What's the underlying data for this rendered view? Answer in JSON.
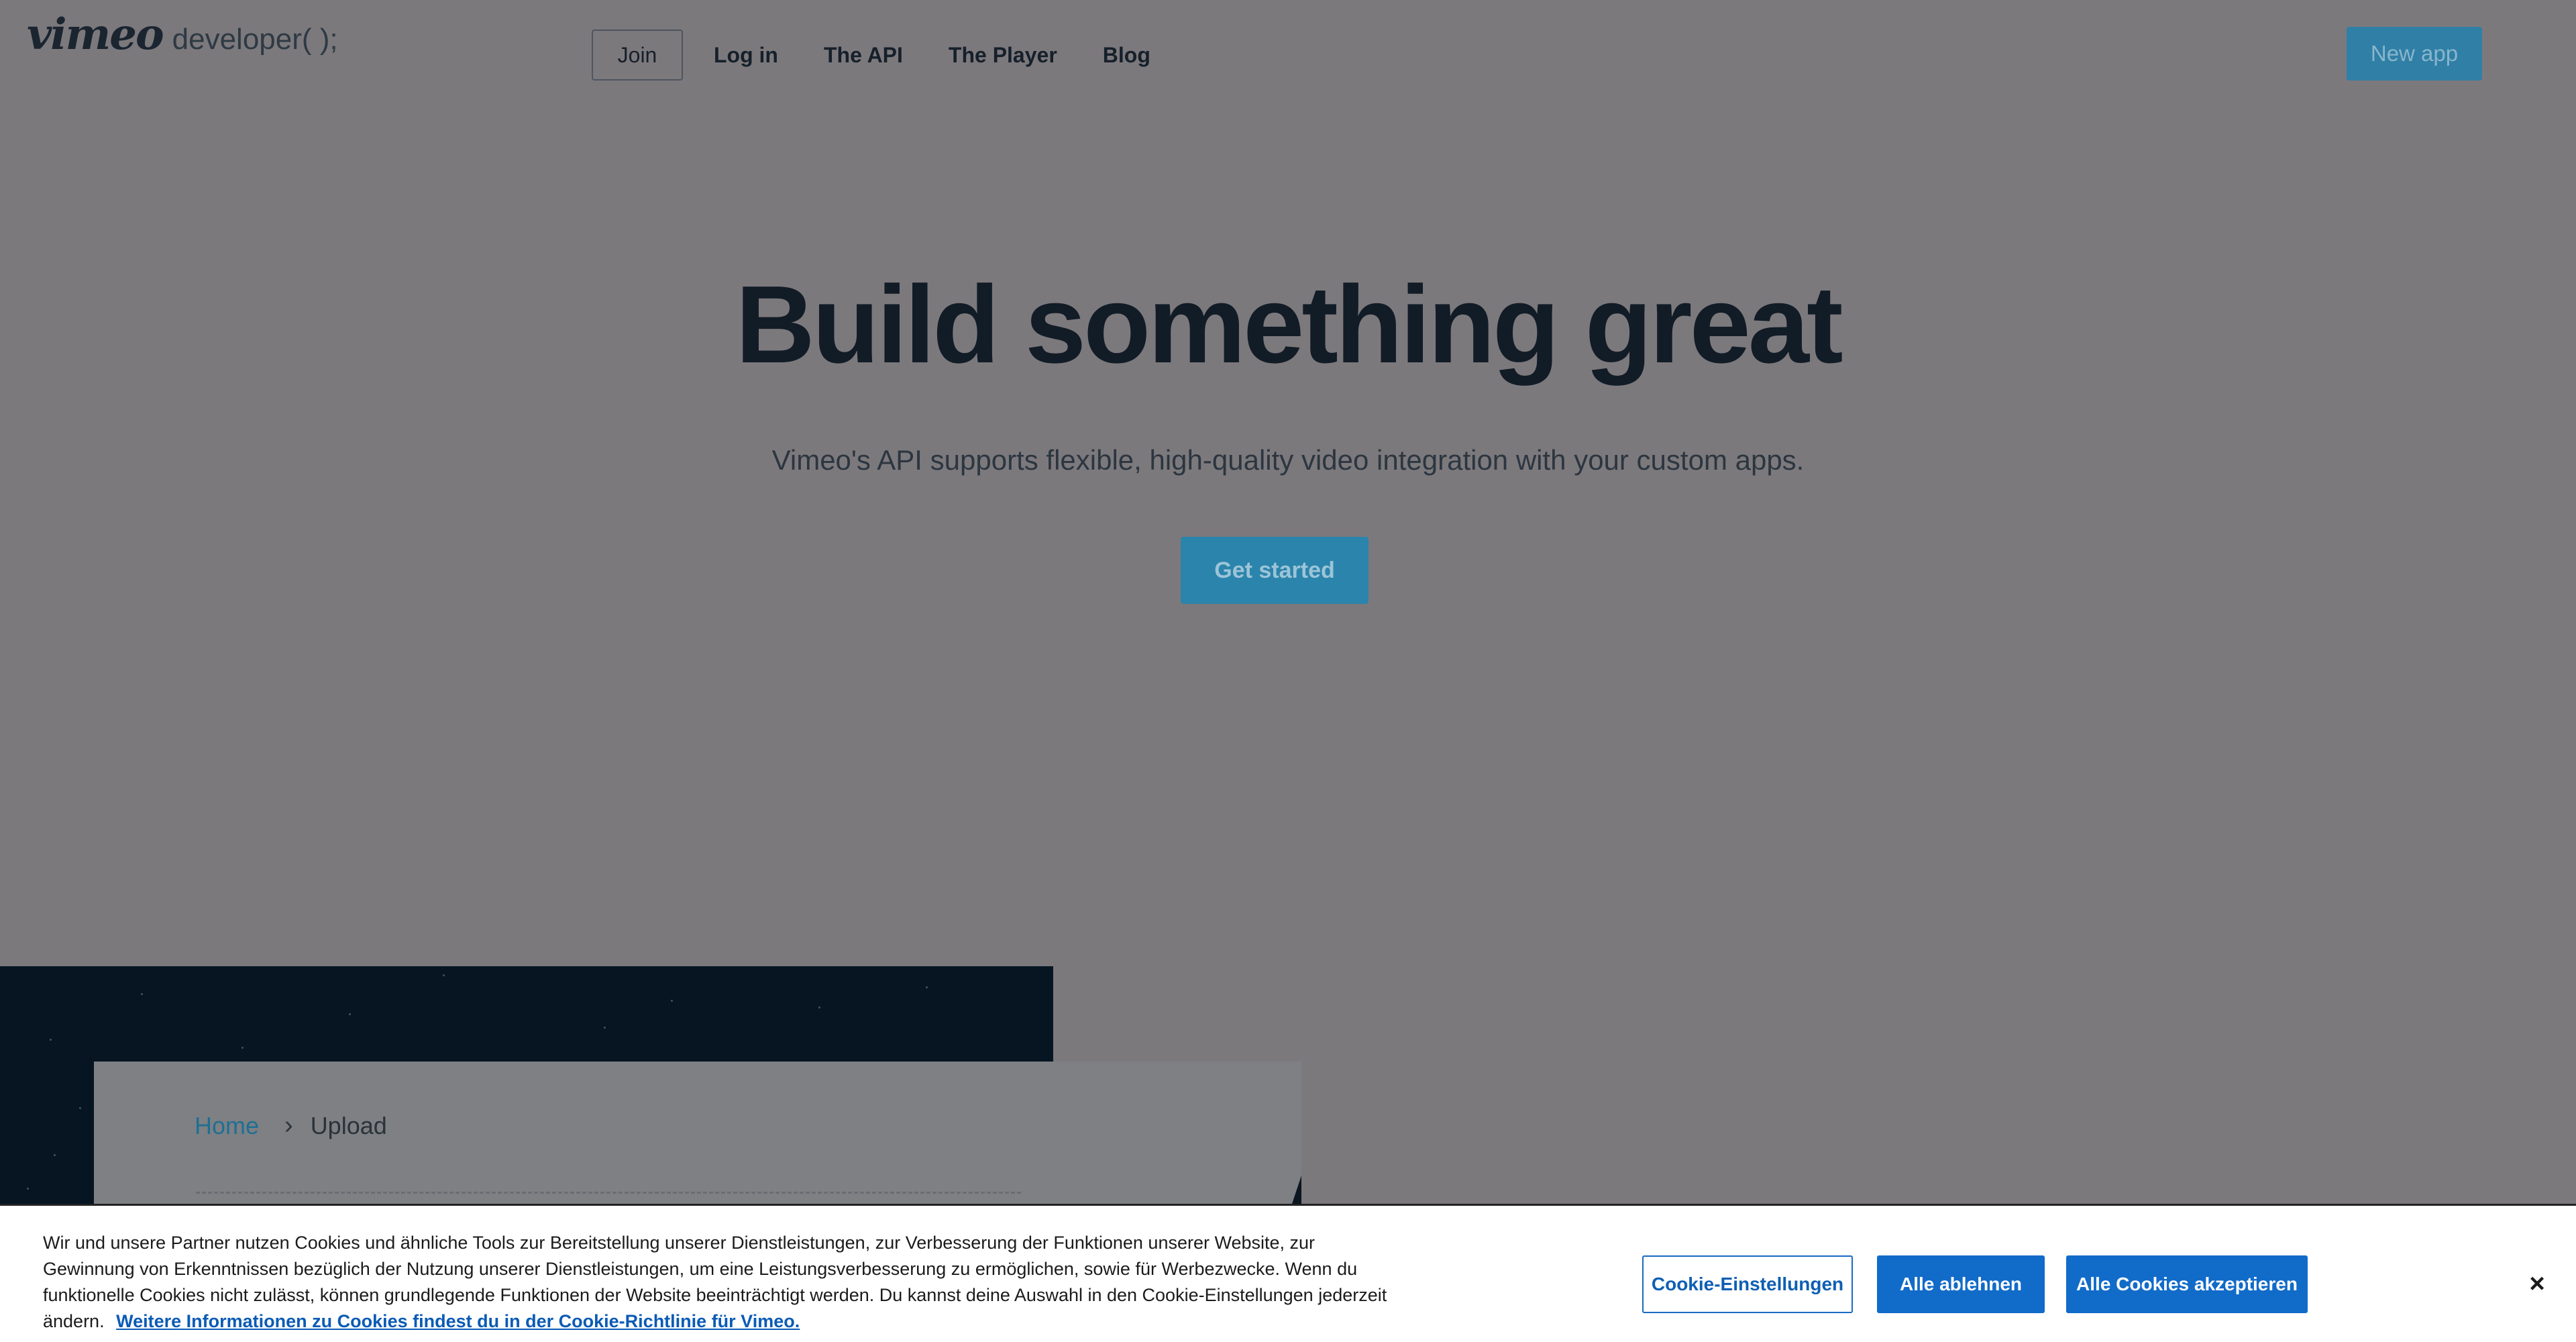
{
  "header": {
    "logo_wordmark": "vimeo",
    "logo_sub": "developer( );",
    "nav": {
      "join": "Join",
      "login": "Log in",
      "api": "The API",
      "player": "The Player",
      "blog": "Blog"
    },
    "new_app": "New app"
  },
  "hero": {
    "title": "Build something great",
    "subtitle": "Vimeo's API supports flexible, high-quality video integration with your custom apps.",
    "cta": "Get started"
  },
  "preview": {
    "breadcrumb": {
      "home": "Home",
      "separator": "›",
      "current": "Upload"
    }
  },
  "cookie_banner": {
    "text": "Wir und unsere Partner nutzen Cookies und ähnliche Tools zur Bereitstellung unserer Dienstleistungen, zur Verbesserung der Funktionen unserer Website, zur Gewinnung von Erkenntnissen bezüglich der Nutzung unserer Dienstleistungen, um eine Leistungsverbesserung zu ermöglichen, sowie für Werbezwecke. Wenn du funktionelle Cookies nicht zulässt, können grundlegende Funktionen der Website beeinträchtigt werden. Du kannst deine Auswahl in den Cookie-Einstellungen jederzeit ändern.",
    "link": "Weitere Informationen zu Cookies findest du in der Cookie-Richtlinie für Vimeo.",
    "settings_button": "Cookie-Einstellungen",
    "reject_button": "Alle ablehnen",
    "accept_button": "Alle Cookies akzeptieren",
    "close": "×"
  },
  "colors": {
    "overlay_background": "#7c797d",
    "primary_button": "#116bc9",
    "vimeo_blue_dimmed": "#2b84ab"
  }
}
